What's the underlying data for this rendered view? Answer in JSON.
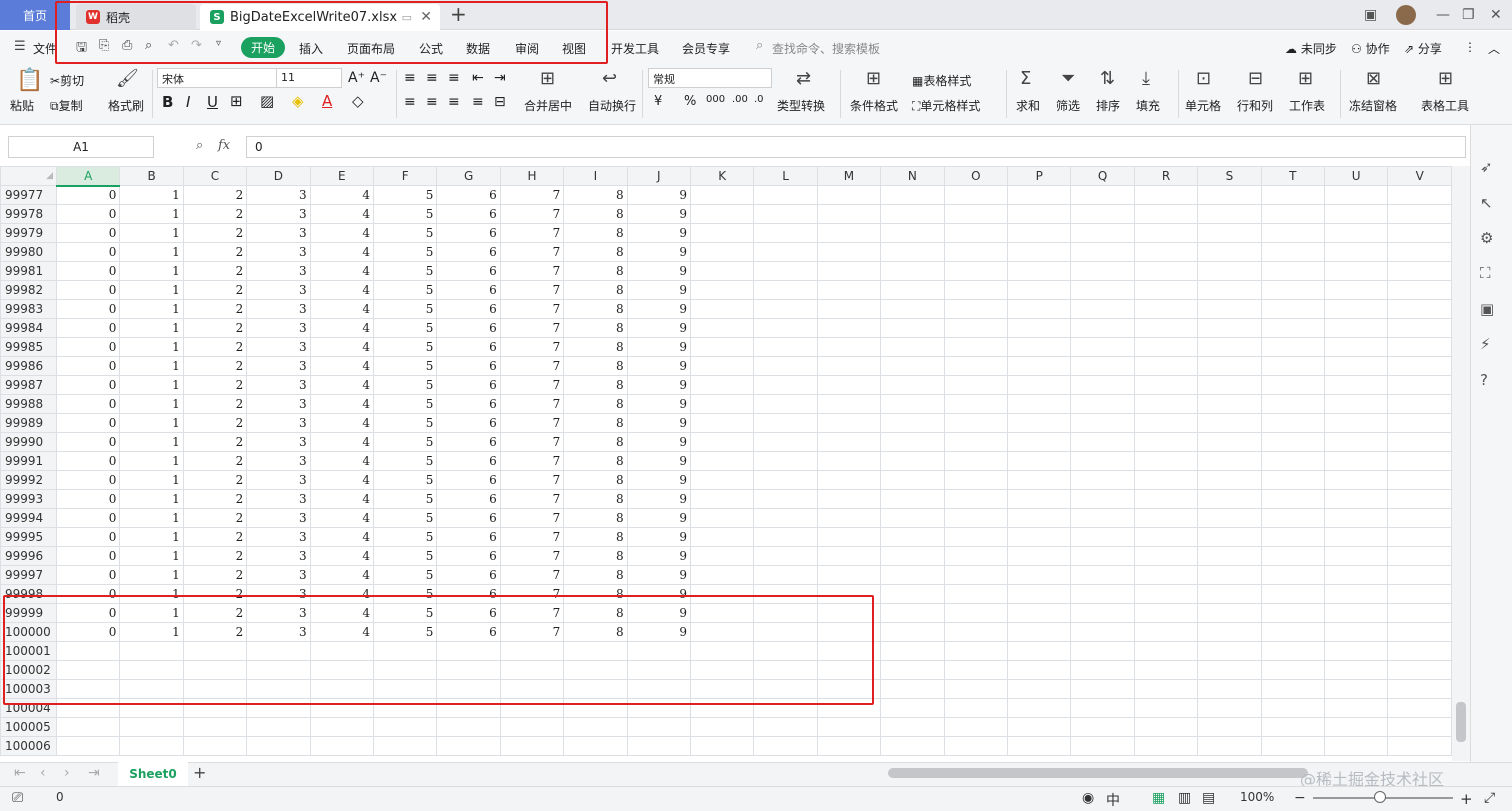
{
  "titlebar": {
    "home_label": "首页",
    "tabs": [
      {
        "label": "稻壳"
      },
      {
        "label": "BigDateExcelWrite07.xlsx"
      }
    ]
  },
  "menu": {
    "file_label": "文件",
    "items": [
      "开始",
      "插入",
      "页面布局",
      "公式",
      "数据",
      "审阅",
      "视图",
      "开发工具",
      "会员专享"
    ],
    "active": "开始",
    "search_placeholder": "查找命令、搜索模板",
    "right_items": [
      "未同步",
      "协作",
      "分享"
    ]
  },
  "ribbon": {
    "paste": "粘贴",
    "cut": "剪切",
    "copy": "复制",
    "format_painter": "格式刷",
    "font_name": "宋体",
    "font_size": "11",
    "merge": "合并居中",
    "wrap": "自动换行",
    "number_format": "常规",
    "type_convert": "类型转换",
    "cond_format": "条件格式",
    "table_style": "表格样式",
    "cell_style": "单元格样式",
    "sum": "求和",
    "filter": "筛选",
    "sort": "排序",
    "fill": "填充",
    "cell": "单元格",
    "rowcol": "行和列",
    "worksheet": "工作表",
    "freeze": "冻结窗格",
    "table_tools": "表格工具"
  },
  "formula": {
    "namebox": "A1",
    "fx": "fx",
    "value": "0"
  },
  "grid": {
    "columns": [
      "A",
      "B",
      "C",
      "D",
      "E",
      "F",
      "G",
      "H",
      "I",
      "J",
      "K",
      "L",
      "M",
      "N",
      "O",
      "P",
      "Q",
      "R",
      "S",
      "T",
      "U",
      "V"
    ],
    "data_rows": [
      "99977",
      "99978",
      "99979",
      "99980",
      "99981",
      "99982",
      "99983",
      "99984",
      "99985",
      "99986",
      "99987",
      "99988",
      "99989",
      "99990",
      "99991",
      "99992",
      "99993",
      "99994",
      "99995",
      "99996",
      "99997",
      "99998",
      "99999",
      "100000"
    ],
    "empty_rows": [
      "100001",
      "100002",
      "100003",
      "100004",
      "100005",
      "100006"
    ],
    "row_values": [
      "0",
      "1",
      "2",
      "3",
      "4",
      "5",
      "6",
      "7",
      "8",
      "9"
    ]
  },
  "sheet": {
    "tab": "Sheet0"
  },
  "status": {
    "cell_value": "0",
    "zoom": "100%"
  },
  "watermark": "@稀土掘金技术社区"
}
